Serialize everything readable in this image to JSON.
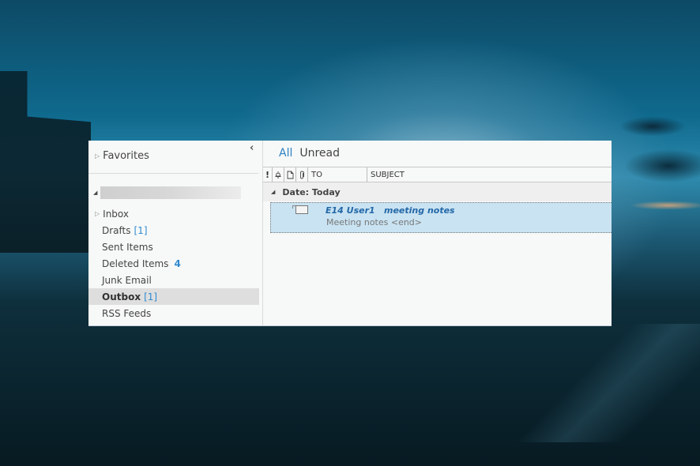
{
  "navigation": {
    "collapse_icon": "chevron-left-icon",
    "favorites_label": "Favorites",
    "account_name_redacted": "",
    "folders": [
      {
        "label": "Inbox",
        "count": "",
        "expandable": true,
        "selected": false
      },
      {
        "label": "Drafts",
        "count": "[1]",
        "expandable": false,
        "selected": false
      },
      {
        "label": "Sent Items",
        "count": "",
        "expandable": false,
        "selected": false
      },
      {
        "label": "Deleted Items",
        "count": "4",
        "expandable": false,
        "selected": false
      },
      {
        "label": "Junk Email",
        "count": "",
        "expandable": false,
        "selected": false
      },
      {
        "label": "Outbox",
        "count": "[1]",
        "expandable": false,
        "selected": true
      },
      {
        "label": "RSS Feeds",
        "count": "",
        "expandable": false,
        "selected": false
      }
    ]
  },
  "message_list": {
    "tabs": [
      {
        "label": "All",
        "active": true
      },
      {
        "label": "Unread",
        "active": false
      }
    ],
    "columns": {
      "importance": "!",
      "reminder_icon": "bell-icon",
      "type_icon": "document-icon",
      "attachment_icon": "paperclip-icon",
      "to": "TO",
      "subject": "SUBJECT"
    },
    "group_label": "Date: Today",
    "messages": [
      {
        "to": "E14 User1",
        "subject": "meeting notes",
        "preview": "Meeting notes <end>",
        "icon": "envelope-icon"
      }
    ]
  },
  "colors": {
    "accent": "#2d7fc1",
    "selected_row": "#c9e3f2",
    "count_blue": "#2f8ad0"
  }
}
